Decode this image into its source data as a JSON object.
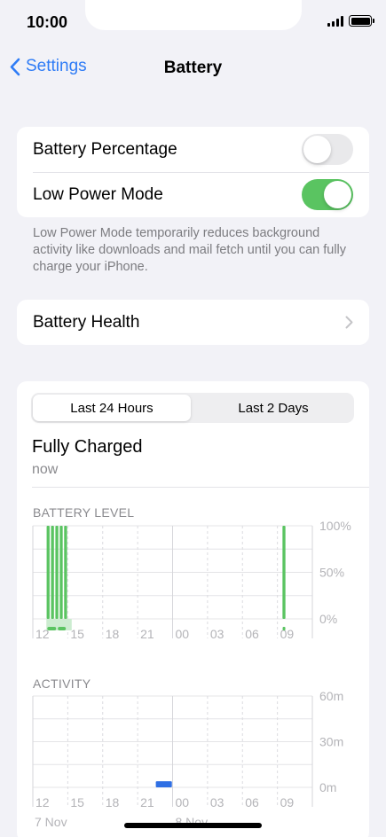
{
  "status": {
    "time": "10:00"
  },
  "nav": {
    "back_label": "Settings",
    "title": "Battery"
  },
  "settings": {
    "battery_percentage_label": "Battery Percentage",
    "battery_percentage_on": false,
    "low_power_label": "Low Power Mode",
    "low_power_on": true,
    "footnote": "Low Power Mode temporarily reduces background activity like downloads and mail fetch until you can fully charge your iPhone.",
    "battery_health_label": "Battery Health"
  },
  "usage": {
    "tabs": [
      "Last 24 Hours",
      "Last 2 Days"
    ],
    "active_tab": 0,
    "charge_title": "Fully Charged",
    "charge_time": "now",
    "accent_green": "#5ac461",
    "accent_blue": "#2f6fe4"
  },
  "chart_data": [
    {
      "type": "bar",
      "title": "BATTERY LEVEL",
      "x_ticks": [
        "12",
        "15",
        "18",
        "21",
        "00",
        "03",
        "06",
        "09"
      ],
      "y_ticks": [
        "100%",
        "50%",
        "0%"
      ],
      "ylim": [
        0,
        100
      ],
      "unit": "%",
      "bars": [
        {
          "slot": 3,
          "value": 100
        },
        {
          "slot": 4,
          "value": 100
        },
        {
          "slot": 5,
          "value": 100
        },
        {
          "slot": 6,
          "value": 100
        },
        {
          "slot": 7,
          "value": 100
        },
        {
          "slot": 57,
          "value": 100
        }
      ],
      "charging_slots": [
        4,
        5,
        6,
        7,
        8
      ],
      "slots_total": 64
    },
    {
      "type": "bar",
      "title": "ACTIVITY",
      "x_ticks": [
        "12",
        "15",
        "18",
        "21",
        "00",
        "03",
        "06",
        "09"
      ],
      "y_ticks": [
        "60m",
        "30m",
        "0m"
      ],
      "ylim": [
        0,
        60
      ],
      "unit": "m",
      "bars": [
        {
          "slot": 7,
          "value": 4
        }
      ],
      "date_labels": [
        "7 Nov",
        "8 Nov"
      ],
      "slots_total": 16
    }
  ]
}
